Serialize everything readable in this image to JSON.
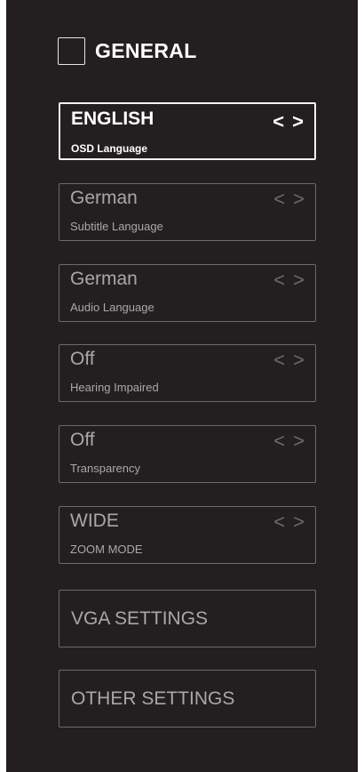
{
  "header": {
    "title": "GENERAL",
    "checkbox_icon": "empty-square-icon"
  },
  "settings": [
    {
      "value": "ENGLISH",
      "label": "OSD Language",
      "prev": "<",
      "next": ">",
      "selected": true
    },
    {
      "value": "German",
      "label": "Subtitle Language",
      "prev": "<",
      "next": ">",
      "selected": false
    },
    {
      "value": "German",
      "label": "Audio Language",
      "prev": "<",
      "next": ">",
      "selected": false
    },
    {
      "value": "Off",
      "label": "Hearing Impaired",
      "prev": "<",
      "next": ">",
      "selected": false
    },
    {
      "value": "Off",
      "label": "Transparency",
      "prev": "<",
      "next": ">",
      "selected": false
    },
    {
      "value": "WIDE",
      "label": "ZOOM MODE",
      "prev": "<",
      "next": ">",
      "selected": false
    }
  ],
  "buttons": {
    "vga_settings": "VGA SETTINGS",
    "other_settings": "OTHER SETTINGS"
  },
  "colors": {
    "panel_background": "#231f20",
    "selected_border": "#f2f2f2",
    "inactive_border": "#6d6a6b",
    "inactive_text": "#a9a7a7",
    "active_text": "#ffffff"
  }
}
